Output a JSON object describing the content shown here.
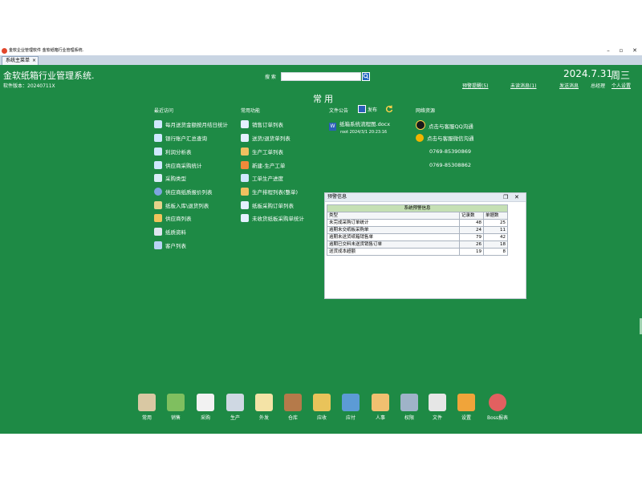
{
  "window": {
    "title": "金软企业管理软件 金软纸箱行业管理系统.",
    "tab_label": "系统主菜单",
    "tab_close": "×",
    "btn_min": "–",
    "btn_max": "▫",
    "btn_close": "✕"
  },
  "header": {
    "system_title": "金软纸箱行业管理系统.",
    "version": "软件版本：20240711X",
    "search_label": "搜 索",
    "search_value": "",
    "date": "2024.7.31",
    "weekday": "周三",
    "links": {
      "warnings": "预警提醒(5)",
      "unread": "未读消息(1)",
      "send_message": "发送消息",
      "general": "总经理",
      "settings": "个人设置"
    }
  },
  "section_title": "常用",
  "columns": {
    "recent": "最近访问",
    "common": "常用功能",
    "files": "文件公告",
    "publish": "发布",
    "network": "网络资源"
  },
  "recent_items": [
    "每月送货金额按月结日统计",
    "银行账户汇总查询",
    "利润分析表",
    "供应商采购统计",
    "采购类型",
    "供应商纸质报价列表",
    "纸板入库\\退货列表",
    "供应商列表",
    "纸质资料",
    "客户列表"
  ],
  "common_items": [
    "销售订单列表",
    "送货/退货单列表",
    "生产工单列表",
    "新建-生产工单",
    "工单生产进度",
    "生产排程列表(整单)",
    "纸板采购订单列表",
    "未收货纸板采购单统计"
  ],
  "file": {
    "name": "纸箱系统流程图.docx",
    "meta": "root  2024/3/1 20:23:16"
  },
  "contacts": [
    "点击与客服QQ沟通",
    "点击与客服微信沟通",
    "0769-85390869",
    "0769-85308862"
  ],
  "alert": {
    "title": "预警信息",
    "caption": "系统预警信息",
    "headers": [
      "类型",
      "记录数",
      "单据数"
    ],
    "rows": [
      [
        "未完成采购订单统计",
        "48",
        "25"
      ],
      [
        "逾期未交纸板采购单",
        "24",
        "11"
      ],
      [
        "逾期未送货纸箱销售单",
        "79",
        "42"
      ],
      [
        "逾期已交料未送货销售订单",
        "26",
        "18"
      ],
      [
        "送货成本超额",
        "19",
        "8"
      ]
    ]
  },
  "dock": [
    {
      "label": "常用",
      "color": "#d9c8a3"
    },
    {
      "label": "销售",
      "color": "#7fbf5f"
    },
    {
      "label": "采购",
      "color": "#f2f2f2"
    },
    {
      "label": "生产",
      "color": "#cfd8e3"
    },
    {
      "label": "外发",
      "color": "#f4e3a6"
    },
    {
      "label": "仓库",
      "color": "#b57a4a"
    },
    {
      "label": "应收",
      "color": "#e9c35a"
    },
    {
      "label": "应付",
      "color": "#5c9bd6"
    },
    {
      "label": "人事",
      "color": "#f0c070"
    },
    {
      "label": "权限",
      "color": "#9fb3c8"
    },
    {
      "label": "文件",
      "color": "#e6e6e6"
    },
    {
      "label": "设置",
      "color": "#f0a43a"
    },
    {
      "label": "Boss报表",
      "color": "#e26060"
    }
  ]
}
